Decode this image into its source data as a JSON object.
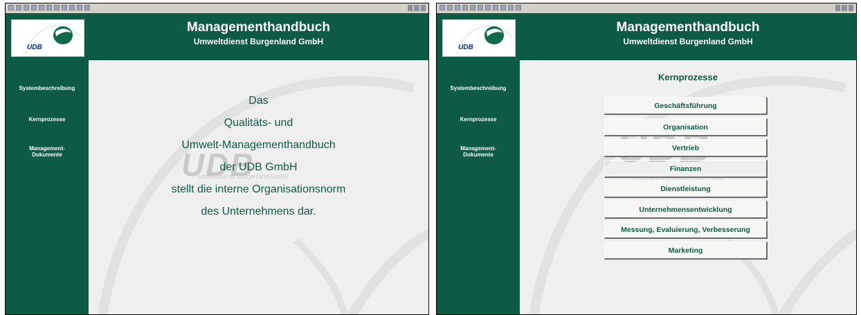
{
  "header": {
    "title": "Managementhandbuch",
    "subtitle": "Umweltdienst Burgenland GmbH",
    "logo_text": "UDB"
  },
  "sidebar": {
    "items": [
      {
        "label": "Systembeschreibung"
      },
      {
        "label": "Kernprozesse"
      },
      {
        "label": "Management-"
      },
      {
        "label": "Dokumente"
      }
    ]
  },
  "watermark": {
    "big": "UDB",
    "small": "Umweltdienst Burgenland GmbH"
  },
  "intro": {
    "lines": [
      "Das",
      "Qualitäts- und",
      "Umwelt-Managementhandbuch",
      "der UDB GmbH",
      "stellt die interne Organisationsnorm",
      "des Unternehmens dar."
    ]
  },
  "kernprozesse": {
    "heading": "Kernprozesse",
    "buttons": [
      "Geschäftsführung",
      "Organisation",
      "Vertrieb",
      "Finanzen",
      "Dienstleistung",
      "Unternehmensentwicklung",
      "Messung, Evaluierung, Verbesserung",
      "Marketing"
    ]
  },
  "colors": {
    "brand_green": "#0d5a45",
    "content_bg": "#efefef",
    "logo_blue": "#0c2f78"
  }
}
